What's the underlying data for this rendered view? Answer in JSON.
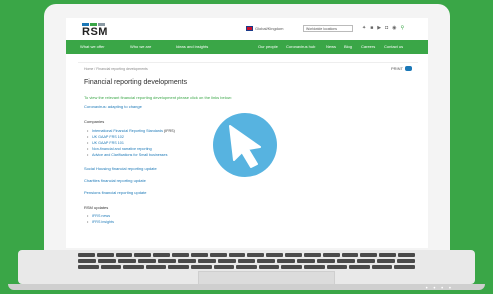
{
  "site": {
    "logo": "RSM",
    "locale": "Global/Kingdom",
    "site_select": "Worldwide locations",
    "social_icons": [
      "twitter-icon",
      "linkedin-icon",
      "youtube-icon",
      "instagram-icon",
      "share-icon",
      "search-icon"
    ]
  },
  "nav": {
    "left": [
      "What we offer",
      "Who we are",
      "Ideas and insights"
    ],
    "right": [
      "Our people",
      "Coronavirus hub",
      "News",
      "Blog",
      "Careers",
      "Contact us"
    ]
  },
  "page": {
    "breadcrumb": "Home  /  Financial reporting developments",
    "print": "PRINT",
    "title": "Financial reporting developments",
    "intro": "To view the relevant financial reporting development please click on the links below:",
    "coronavirus_link": "Coronavirus: adapting to change",
    "companies_label": "Companies",
    "companies_items": [
      {
        "text": "International Financial Reporting Standards",
        "suffix": " (IFRS)"
      },
      {
        "text": "UK GAAP FRS 102",
        "suffix": ""
      },
      {
        "text": "UK GAAP FRS 101",
        "suffix": ""
      },
      {
        "text": "Non-financial and narrative reporting",
        "suffix": ""
      },
      {
        "text": "Advice and Clarifications for Small businesses",
        "suffix": ""
      }
    ],
    "social_housing": "Social Housing financial reporting update",
    "charities": "Charities financial reporting update",
    "pensions": "Pensions financial reporting update",
    "rsm_updates_label": "RSM updates",
    "rsm_items": [
      "IFRS news",
      "IFRS insights"
    ]
  },
  "colors": {
    "brand_green": "#3aa647",
    "link_blue": "#1b78b7",
    "cursor_badge": "#57b3e0"
  }
}
